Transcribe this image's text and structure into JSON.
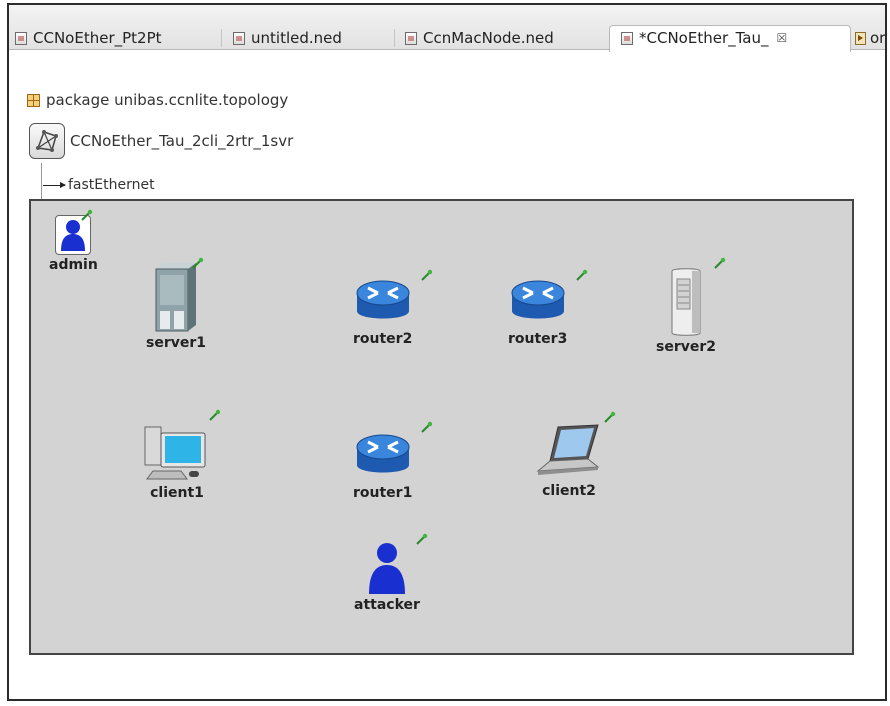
{
  "tabs": [
    {
      "label": "CCNoEther_Pt2Pt",
      "icon": "ned-file-icon"
    },
    {
      "label": "untitled.ned",
      "icon": "ned-file-icon"
    },
    {
      "label": "CcnMacNode.ned",
      "icon": "ned-file-icon"
    },
    {
      "label": "*CCNoEther_Tau_",
      "icon": "ned-file-icon",
      "active": true,
      "close": "☒"
    },
    {
      "label": "or",
      "icon": "run-file-icon"
    }
  ],
  "editor": {
    "package_line": "package unibas.ccnlite.topology",
    "network_name": "CCNoEther_Tau_2cli_2rtr_1svr",
    "connection_type": "fastEthernet"
  },
  "nodes": {
    "admin": "admin",
    "server1": "server1",
    "router2": "router2",
    "router3": "router3",
    "server2": "server2",
    "client1": "client1",
    "router1": "router1",
    "client2": "client2",
    "attacker": "attacker"
  },
  "colors": {
    "canvas_bg": "#d3d3d3",
    "router_blue": "#1f5fb0",
    "person_blue": "#1a2fd0"
  }
}
